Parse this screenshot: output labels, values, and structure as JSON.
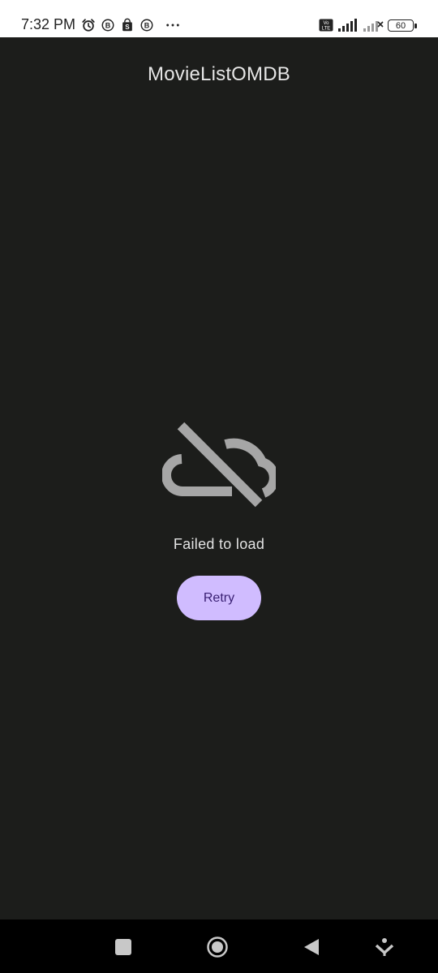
{
  "status_bar": {
    "time": "7:32 PM",
    "battery": "60",
    "icons": [
      "alarm-icon",
      "b-badge-icon",
      "shopping-bag-icon",
      "b-badge-icon",
      "more-dots-icon",
      "volte-icon",
      "signal-icon",
      "signal-no-service-icon",
      "battery-icon"
    ]
  },
  "app_bar": {
    "title": "MovieListOMDB"
  },
  "error_state": {
    "icon": "cloud-off-icon",
    "message": "Failed to load",
    "retry_label": "Retry"
  },
  "nav_bar": {
    "buttons": [
      "recents-button",
      "home-button",
      "back-button",
      "accessibility-button"
    ]
  },
  "colors": {
    "background": "#1c1d1b",
    "accent": "#d0bcff",
    "accent_text": "#381e72",
    "icon_gray": "#a6a6a6"
  }
}
